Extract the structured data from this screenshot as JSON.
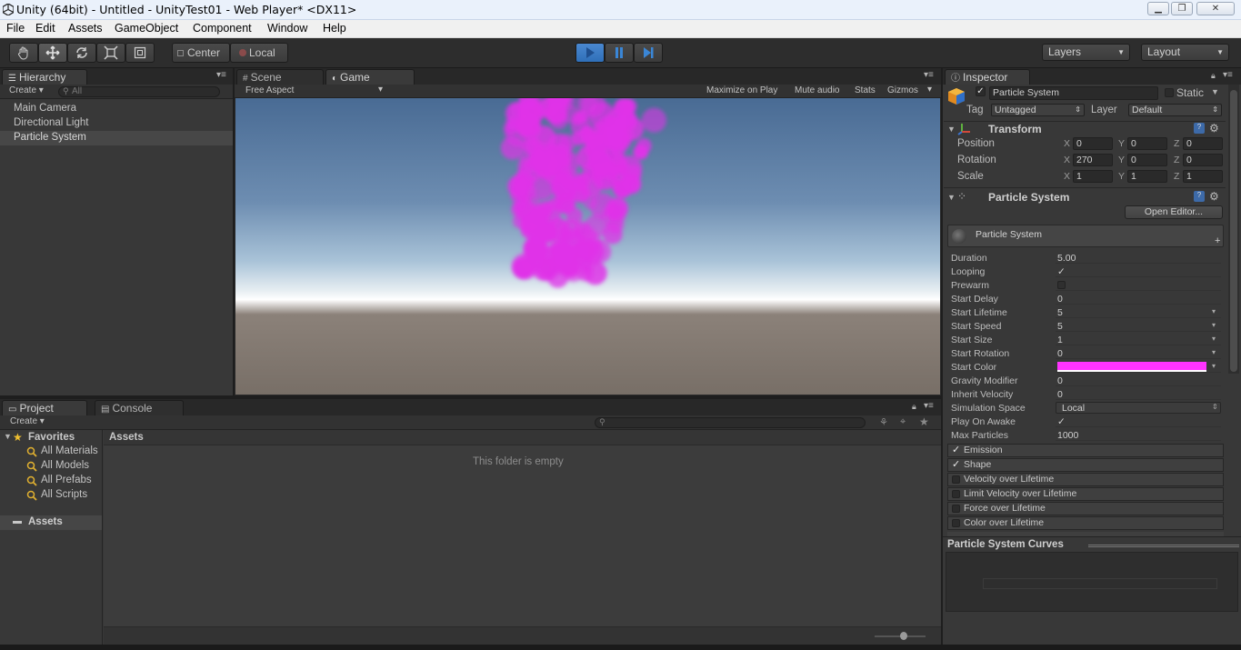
{
  "window": {
    "title": "Unity (64bit) - Untitled - UnityTest01 - Web Player* <DX11>"
  },
  "menu": [
    "File",
    "Edit",
    "Assets",
    "GameObject",
    "Component",
    "Window",
    "Help"
  ],
  "toolbar": {
    "pivot": "Center",
    "space": "Local",
    "layers": "Layers",
    "layout": "Layout"
  },
  "hierarchy": {
    "tab": "Hierarchy",
    "create": "Create",
    "search_placeholder": "All",
    "items": [
      "Main Camera",
      "Directional Light",
      "Particle System"
    ],
    "selected": "Particle System"
  },
  "views": {
    "scene_tab": "Scene",
    "game_tab": "Game",
    "aspect": "Free Aspect",
    "maximize": "Maximize on Play",
    "mute": "Mute audio",
    "stats": "Stats",
    "gizmos": "Gizmos"
  },
  "project": {
    "tab": "Project",
    "console_tab": "Console",
    "create": "Create",
    "favorites_label": "Favorites",
    "favorites": [
      "All Materials",
      "All Models",
      "All Prefabs",
      "All Scripts"
    ],
    "assets_label": "Assets",
    "breadcrumb": "Assets",
    "empty_message": "This folder is empty"
  },
  "inspector": {
    "tab": "Inspector",
    "object_name": "Particle System",
    "static_label": "Static",
    "tag_label": "Tag",
    "tag_value": "Untagged",
    "layer_label": "Layer",
    "layer_value": "Default",
    "transform": {
      "title": "Transform",
      "position_label": "Position",
      "rotation_label": "Rotation",
      "scale_label": "Scale",
      "position": {
        "x": "0",
        "y": "0",
        "z": "0"
      },
      "rotation": {
        "x": "270",
        "y": "0",
        "z": "0"
      },
      "scale": {
        "x": "1",
        "y": "1",
        "z": "1"
      }
    },
    "particle_component": "Particle System",
    "open_editor": "Open Editor...",
    "system_header": "Particle System",
    "properties": [
      {
        "label": "Duration",
        "value": "5.00"
      },
      {
        "label": "Looping",
        "value": "✓"
      },
      {
        "label": "Prewarm",
        "value": ""
      },
      {
        "label": "Start Delay",
        "value": "0"
      },
      {
        "label": "Start Lifetime",
        "value": "5"
      },
      {
        "label": "Start Speed",
        "value": "5"
      },
      {
        "label": "Start Size",
        "value": "1"
      },
      {
        "label": "Start Rotation",
        "value": "0"
      },
      {
        "label": "Start Color",
        "value": ""
      },
      {
        "label": "Gravity Modifier",
        "value": "0"
      },
      {
        "label": "Inherit Velocity",
        "value": "0"
      },
      {
        "label": "Simulation Space",
        "value": "Local"
      },
      {
        "label": "Play On Awake",
        "value": "✓"
      },
      {
        "label": "Max Particles",
        "value": "1000"
      }
    ],
    "start_color": "#ff33ff",
    "modules": [
      {
        "label": "Emission",
        "enabled": true
      },
      {
        "label": "Shape",
        "enabled": true
      },
      {
        "label": "Velocity over Lifetime",
        "enabled": false
      },
      {
        "label": "Limit Velocity over Lifetime",
        "enabled": false
      },
      {
        "label": "Force over Lifetime",
        "enabled": false
      },
      {
        "label": "Color over Lifetime",
        "enabled": false
      }
    ],
    "curves_title": "Particle System Curves"
  },
  "colors": {
    "particles": "#e033e8",
    "play_active": "#2f7fd8"
  }
}
